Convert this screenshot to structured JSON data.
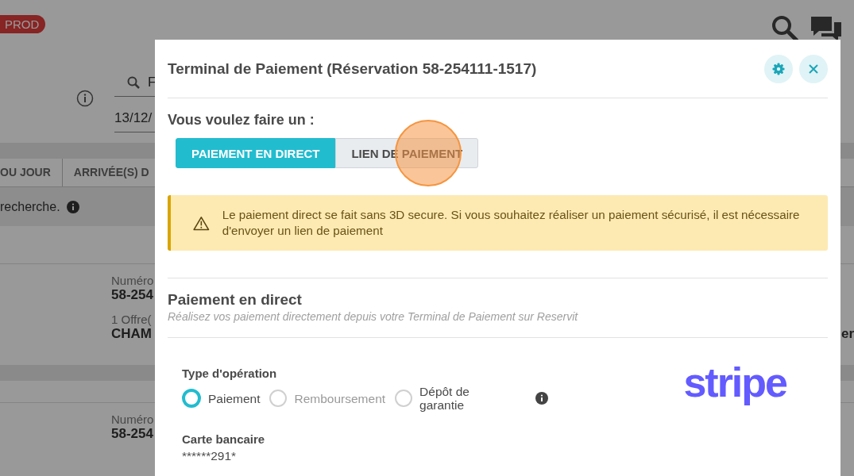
{
  "environment_badge": "PROD",
  "background": {
    "search_field": {
      "value": "F"
    },
    "date_field": {
      "value": "13/12/"
    },
    "tabs": [
      {
        "label": "OU JOUR"
      },
      {
        "label": "ARRIVÉE(S) D"
      }
    ],
    "search_hint": "recherche.",
    "bookings": [
      {
        "number_label": "Numéro",
        "number": "58-254",
        "offers": "1 Offre(",
        "room": "CHAM"
      },
      {
        "number_label": "Numéro",
        "number": "58-254"
      }
    ],
    "edge_text": "er"
  },
  "modal": {
    "title": "Terminal de Paiement (Réservation 58-254111-1517)",
    "prompt": "Vous voulez faire un :",
    "mode_options": [
      {
        "label": "PAIEMENT EN DIRECT",
        "selected": true
      },
      {
        "label": "LIEN DE PAIEMENT",
        "selected": false
      }
    ],
    "alert": "Le paiement direct se fait sans 3D secure. Si vous souhaitez réaliser un paiement sécurisé, il est nécessaire d'envoyer un lien de paiement",
    "section_title": "Paiement en direct",
    "section_subtitle": "Réalisez vos paiement directement depuis votre Terminal de Paiement sur Reservit",
    "operation_type": {
      "label": "Type d'opération",
      "options": [
        {
          "label": "Paiement",
          "selected": true,
          "disabled": false
        },
        {
          "label": "Remboursement",
          "selected": false,
          "disabled": true
        },
        {
          "label": "Dépôt de garantie",
          "selected": false,
          "disabled": false
        }
      ]
    },
    "logo_text": "stripe",
    "card": {
      "label": "Carte bancaire",
      "value": "******291*"
    }
  }
}
